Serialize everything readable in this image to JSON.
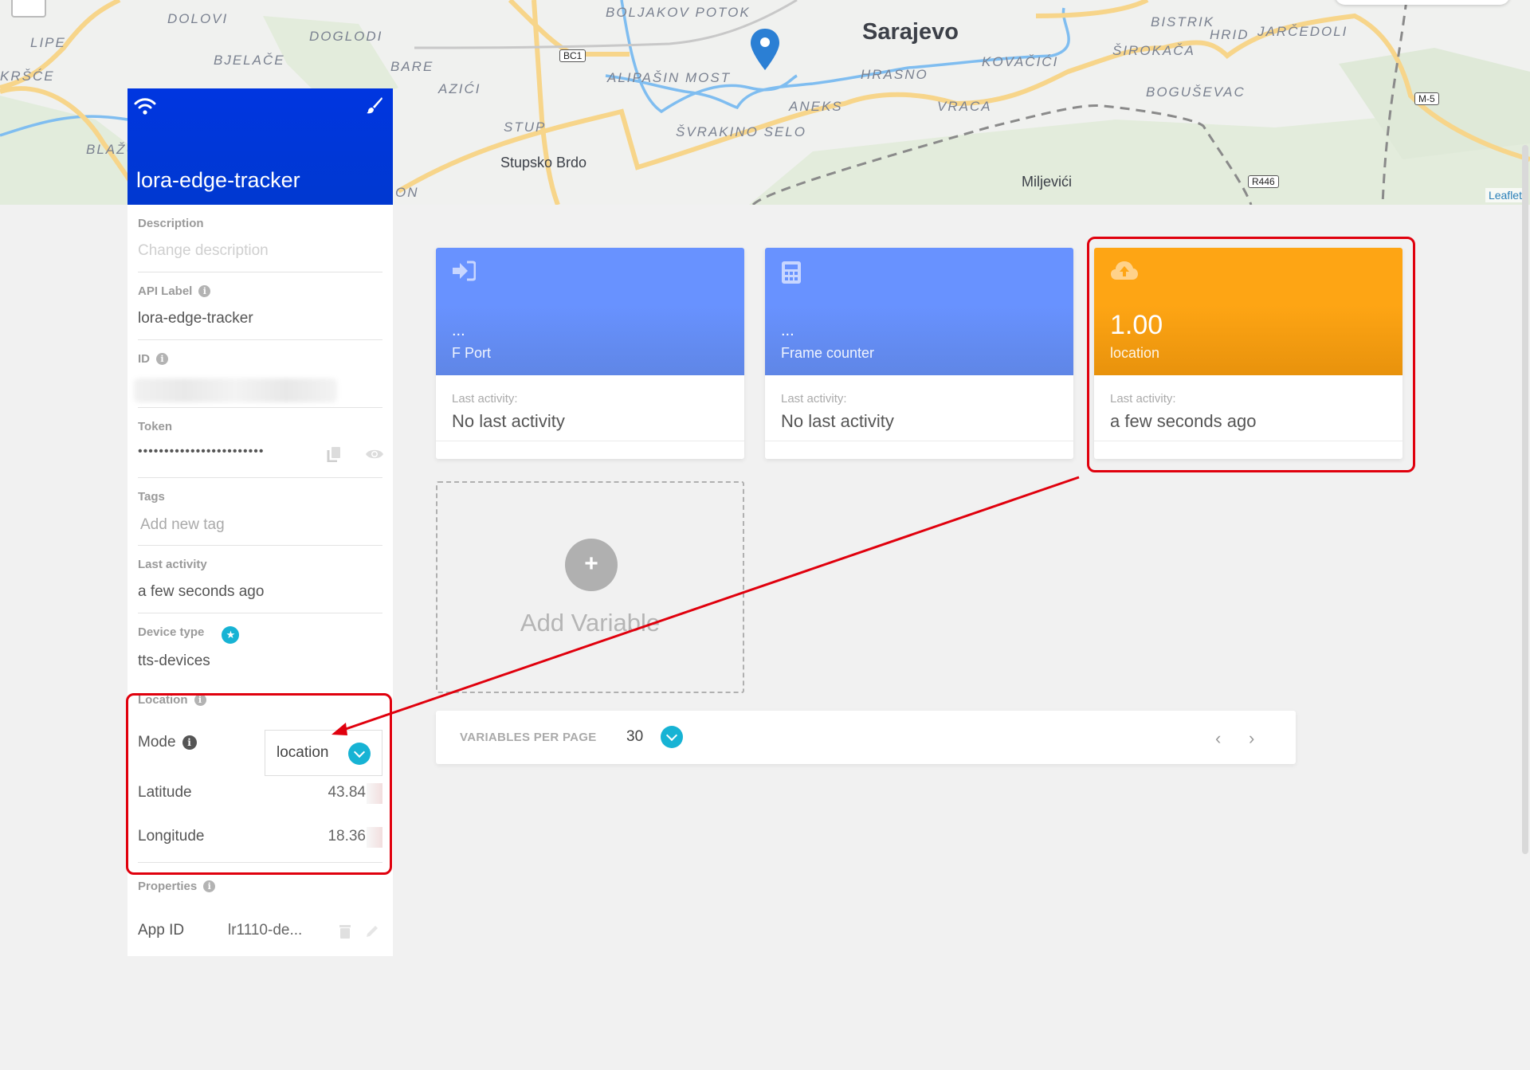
{
  "map": {
    "labels": [
      {
        "text": "DOLOVI",
        "kind": "district"
      },
      {
        "text": "LIPE",
        "kind": "district"
      },
      {
        "text": "DOGLODI",
        "kind": "district"
      },
      {
        "text": "BJELAČE",
        "kind": "district"
      },
      {
        "text": "KRŠĆE",
        "kind": "district"
      },
      {
        "text": "BARE",
        "kind": "district"
      },
      {
        "text": "AZIĆI",
        "kind": "district"
      },
      {
        "text": "BLAŽU",
        "kind": "district"
      },
      {
        "text": "BOLJAKOV POTOK",
        "kind": "district"
      },
      {
        "text": "ALIPAŠIN MOST",
        "kind": "district"
      },
      {
        "text": "STUP",
        "kind": "district"
      },
      {
        "text": "ŠVRAKINO SELO",
        "kind": "district"
      },
      {
        "text": "ANEKS",
        "kind": "district"
      },
      {
        "text": "HRASNO",
        "kind": "district"
      },
      {
        "text": "KOVAČIĆI",
        "kind": "district"
      },
      {
        "text": "VRACA",
        "kind": "district"
      },
      {
        "text": "BISTRIK",
        "kind": "district"
      },
      {
        "text": "ŠIROKAČA",
        "kind": "district"
      },
      {
        "text": "HRID",
        "kind": "district"
      },
      {
        "text": "JARČEDOLI",
        "kind": "district"
      },
      {
        "text": "BOGUŠEVAC",
        "kind": "district"
      },
      {
        "text": "ON",
        "kind": "district"
      }
    ],
    "city": "Sarajevo",
    "towns": [
      "Stupsko Brdo",
      "Miljevići"
    ],
    "road_shields": [
      "BC1",
      "M-5",
      "R446"
    ],
    "attribution": "Leaflet",
    "marker_color": "#2b7fd4"
  },
  "device": {
    "name": "lora-edge-tracker",
    "header_color": "#0036e0",
    "fields": {
      "description": {
        "label": "Description",
        "placeholder": "Change description"
      },
      "api_label": {
        "label": "API Label",
        "value": "lora-edge-tracker"
      },
      "id": {
        "label": "ID"
      },
      "token": {
        "label": "Token",
        "value": "••••••••••••••••••••••••"
      },
      "tags": {
        "label": "Tags",
        "placeholder": "Add new tag"
      },
      "last_activity": {
        "label": "Last activity",
        "value": "a few seconds ago"
      },
      "device_type": {
        "label": "Device type",
        "value": "tts-devices"
      },
      "location": {
        "label": "Location",
        "mode_label": "Mode",
        "mode_value": "location",
        "latitude_label": "Latitude",
        "latitude_value": "43.84",
        "longitude_label": "Longitude",
        "longitude_value": "18.36"
      },
      "properties": {
        "label": "Properties",
        "items": [
          {
            "key": "App ID",
            "value": "lr1110-de..."
          }
        ]
      }
    }
  },
  "variables": {
    "cards": [
      {
        "icon": "sign-in-icon",
        "value": "...",
        "name": "F Port",
        "last_activity_label": "Last activity:",
        "last_activity": "No last activity",
        "color": "#6892ff"
      },
      {
        "icon": "calculator-icon",
        "value": "...",
        "name": "Frame counter",
        "last_activity_label": "Last activity:",
        "last_activity": "No last activity",
        "color": "#6892ff"
      },
      {
        "icon": "cloud-upload-icon",
        "value": "1.00",
        "name": "location",
        "last_activity_label": "Last activity:",
        "last_activity": "a few seconds ago",
        "color": "#fea514"
      }
    ],
    "add_label": "Add Variable",
    "pager": {
      "label": "VARIABLES PER PAGE",
      "per_page": "30"
    }
  },
  "annotation_color": "#e0000d"
}
